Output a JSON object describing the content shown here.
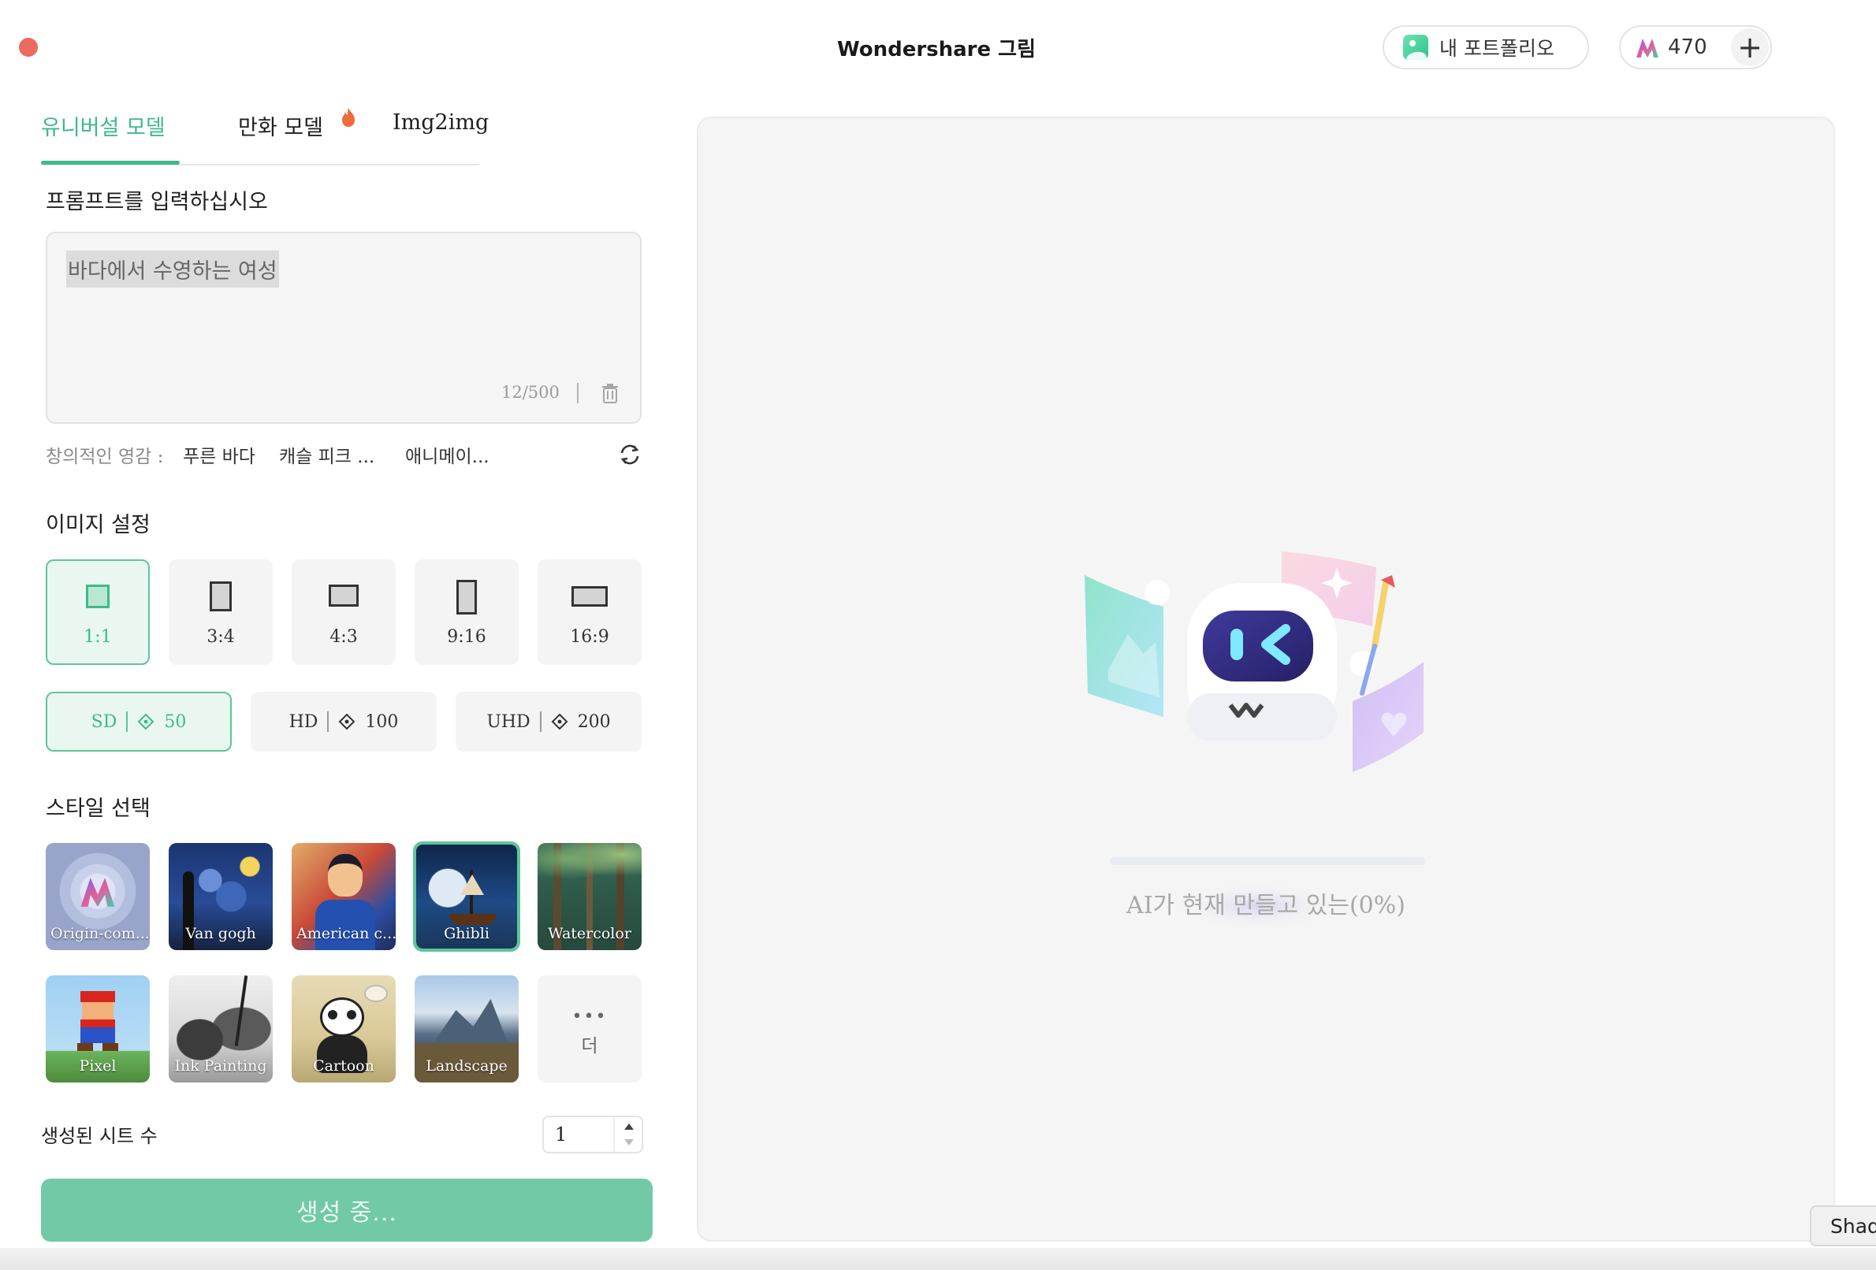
{
  "window": {
    "title": "Wondershare 그림",
    "portfolio_label": "내 포트폴리오",
    "credits": "470",
    "add_credits_label": "+"
  },
  "tabs": [
    {
      "label": "유니버설 모델",
      "active": true
    },
    {
      "label": "만화 모델",
      "active": false,
      "badge_icon": "fire-icon"
    },
    {
      "label": "Img2img",
      "active": false
    }
  ],
  "prompt": {
    "section_title": "프롬프트를 입력하십시오",
    "value": "바다에서 수영하는 여성",
    "char_count": "12/500"
  },
  "inspiration": {
    "label": "창의적인 영감 : ",
    "items": [
      "푸른 바다",
      "캐슬 피크 ...",
      "애니메이..."
    ]
  },
  "image_settings": {
    "section_title": "이미지 설정",
    "ratios": [
      {
        "label": "1:1",
        "selected": true
      },
      {
        "label": "3:4",
        "selected": false
      },
      {
        "label": "4:3",
        "selected": false
      },
      {
        "label": "9:16",
        "selected": false
      },
      {
        "label": "16:9",
        "selected": false
      }
    ],
    "qualities": [
      {
        "label": "SD",
        "cost": "50",
        "selected": true
      },
      {
        "label": "HD",
        "cost": "100",
        "selected": false
      },
      {
        "label": "UHD",
        "cost": "200",
        "selected": false
      }
    ]
  },
  "styles": {
    "section_title": "스타일 선택",
    "items": [
      {
        "label": "Origin-com...",
        "selected": false
      },
      {
        "label": "Van gogh",
        "selected": false
      },
      {
        "label": "American c...",
        "selected": false
      },
      {
        "label": "Ghibli",
        "selected": true
      },
      {
        "label": "Watercolor",
        "selected": false
      },
      {
        "label": "Pixel",
        "selected": false
      },
      {
        "label": "Ink Painting",
        "selected": false
      },
      {
        "label": "Cartoon",
        "selected": false
      },
      {
        "label": "Landscape",
        "selected": false
      }
    ],
    "more_label": "더",
    "more_dots": "•••"
  },
  "sheet_count": {
    "label": "생성된 시트 수",
    "value": "1"
  },
  "generate_button": {
    "label": "생성 중..."
  },
  "canvas": {
    "progress_text": "AI가 현재 만들고 있는(0%)",
    "progress_percent": 0
  },
  "side_tab": {
    "label": "Shadow"
  },
  "colors": {
    "accent": "#3fb98a",
    "accent_light": "#e9f7f0",
    "generate_button": "#72c9a6",
    "traffic_close": "#ec6a5e"
  }
}
